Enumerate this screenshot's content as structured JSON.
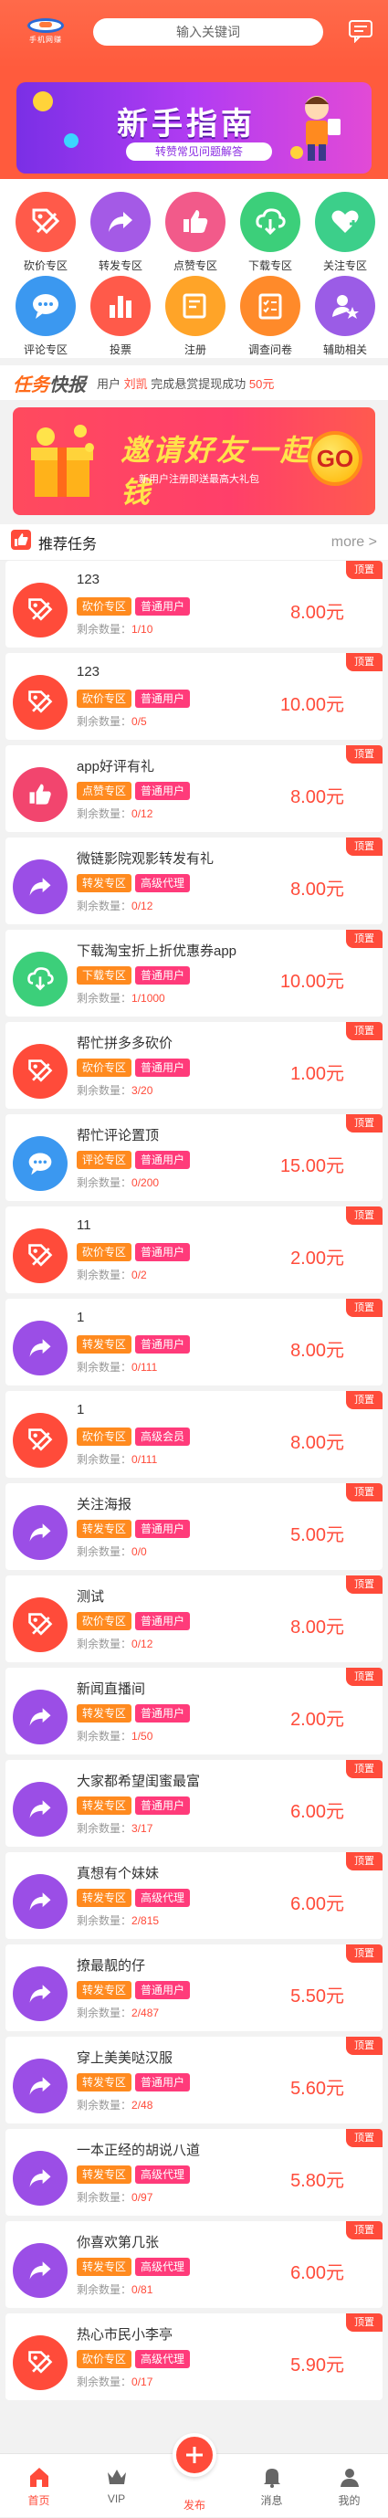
{
  "header": {
    "logo_text": "手机网赚",
    "search_placeholder": "输入关键词"
  },
  "banner": {
    "title": "新手指南",
    "subtitle": "转赞常见问题解答"
  },
  "categories": [
    {
      "label": "砍价专区",
      "icon": "tag-icon",
      "color": "#ff5a4a"
    },
    {
      "label": "转发专区",
      "icon": "share-icon",
      "color": "#a45ae6"
    },
    {
      "label": "点赞专区",
      "icon": "thumbs-up-icon",
      "color": "#f25a8a"
    },
    {
      "label": "下载专区",
      "icon": "download-icon",
      "color": "#3ccf7a"
    },
    {
      "label": "关注专区",
      "icon": "heart-plus-icon",
      "color": "#3ccf8a"
    },
    {
      "label": "评论专区",
      "icon": "comment-icon",
      "color": "#3b98f0"
    },
    {
      "label": "投票",
      "icon": "bar-chart-icon",
      "color": "#ff5a4a"
    },
    {
      "label": "注册",
      "icon": "edit-icon",
      "color": "#ffa428"
    },
    {
      "label": "调查问卷",
      "icon": "survey-icon",
      "color": "#ff8a2a"
    },
    {
      "label": "辅助相关",
      "icon": "user-star-icon",
      "color": "#9b5ce6"
    }
  ],
  "flash": {
    "title_a": "任务",
    "title_b": "快报",
    "prefix": "用户",
    "user": "刘凯",
    "middle": "完成悬赏提现成功",
    "amount": "50元"
  },
  "invite": {
    "title": "邀请好友一起赚钱",
    "subtitle": "新用户注册即送最高大礼包",
    "go": "GO"
  },
  "recommend": {
    "title": "推荐任务",
    "more": "more >"
  },
  "remain_label": "剩余数量：",
  "top_label": "顶置",
  "tag_colors": {
    "砍价专区": "#ff8a1f",
    "转发专区": "#ff8a1f",
    "点赞专区": "#ff8a1f",
    "下载专区": "#ff8a1f",
    "评论专区": "#ff8a1f",
    "普通用户": "#ff3b7a",
    "高级代理": "#ff3b7a",
    "高级会员": "#ff3b7a"
  },
  "tasks": [
    {
      "title": "123",
      "tag1": "砍价专区",
      "tag2": "普通用户",
      "remain": "1/10",
      "price": "8.00元",
      "icon": "tag-icon",
      "color": "#ff4b3a"
    },
    {
      "title": "123",
      "tag1": "砍价专区",
      "tag2": "普通用户",
      "remain": "0/5",
      "price": "10.00元",
      "icon": "tag-icon",
      "color": "#ff4b3a"
    },
    {
      "title": "app好评有礼",
      "tag1": "点赞专区",
      "tag2": "普通用户",
      "remain": "0/12",
      "price": "8.00元",
      "icon": "thumbs-up-icon",
      "color": "#f2456e"
    },
    {
      "title": "微链影院观影转发有礼",
      "tag1": "转发专区",
      "tag2": "高级代理",
      "remain": "0/12",
      "price": "8.00元",
      "icon": "share-icon",
      "color": "#9b4ee6"
    },
    {
      "title": "下载淘宝折上折优惠券app",
      "tag1": "下载专区",
      "tag2": "普通用户",
      "remain": "1/1000",
      "price": "10.00元",
      "icon": "download-icon",
      "color": "#3ccf7a"
    },
    {
      "title": "帮忙拼多多砍价",
      "tag1": "砍价专区",
      "tag2": "普通用户",
      "remain": "3/20",
      "price": "1.00元",
      "icon": "tag-icon",
      "color": "#ff4b3a"
    },
    {
      "title": "帮忙评论置顶",
      "tag1": "评论专区",
      "tag2": "普通用户",
      "remain": "0/200",
      "price": "15.00元",
      "icon": "comment-icon",
      "color": "#3b98f0"
    },
    {
      "title": "11",
      "tag1": "砍价专区",
      "tag2": "普通用户",
      "remain": "0/2",
      "price": "2.00元",
      "icon": "tag-icon",
      "color": "#ff4b3a"
    },
    {
      "title": "1",
      "tag1": "转发专区",
      "tag2": "普通用户",
      "remain": "0/111",
      "price": "8.00元",
      "icon": "share-icon",
      "color": "#9b4ee6"
    },
    {
      "title": "1",
      "tag1": "砍价专区",
      "tag2": "高级会员",
      "remain": "0/111",
      "price": "8.00元",
      "icon": "tag-icon",
      "color": "#ff4b3a"
    },
    {
      "title": "关注海报",
      "tag1": "转发专区",
      "tag2": "普通用户",
      "remain": "0/0",
      "price": "5.00元",
      "icon": "share-icon",
      "color": "#9b4ee6"
    },
    {
      "title": "测试",
      "tag1": "砍价专区",
      "tag2": "普通用户",
      "remain": "0/12",
      "price": "8.00元",
      "icon": "tag-icon",
      "color": "#ff4b3a"
    },
    {
      "title": "新闻直播间",
      "tag1": "转发专区",
      "tag2": "普通用户",
      "remain": "1/50",
      "price": "2.00元",
      "icon": "share-icon",
      "color": "#9b4ee6"
    },
    {
      "title": "大家都希望闺蜜最富",
      "tag1": "转发专区",
      "tag2": "普通用户",
      "remain": "3/17",
      "price": "6.00元",
      "icon": "share-icon",
      "color": "#9b4ee6"
    },
    {
      "title": "真想有个妹妹",
      "tag1": "转发专区",
      "tag2": "高级代理",
      "remain": "2/815",
      "price": "6.00元",
      "icon": "share-icon",
      "color": "#9b4ee6"
    },
    {
      "title": "撩最靓的仔",
      "tag1": "转发专区",
      "tag2": "普通用户",
      "remain": "2/487",
      "price": "5.50元",
      "icon": "share-icon",
      "color": "#9b4ee6"
    },
    {
      "title": "穿上美美哒汉服",
      "tag1": "转发专区",
      "tag2": "普通用户",
      "remain": "2/48",
      "price": "5.60元",
      "icon": "share-icon",
      "color": "#9b4ee6"
    },
    {
      "title": "一本正经的胡说八道",
      "tag1": "转发专区",
      "tag2": "高级代理",
      "remain": "0/97",
      "price": "5.80元",
      "icon": "share-icon",
      "color": "#9b4ee6"
    },
    {
      "title": "你喜欢第几张",
      "tag1": "转发专区",
      "tag2": "高级代理",
      "remain": "0/81",
      "price": "6.00元",
      "icon": "share-icon",
      "color": "#9b4ee6"
    },
    {
      "title": "热心市民小李亭",
      "tag1": "砍价专区",
      "tag2": "高级代理",
      "remain": "0/17",
      "price": "5.90元",
      "icon": "tag-icon",
      "color": "#ff4b3a"
    }
  ],
  "tabbar": {
    "home": "首页",
    "vip": "VIP",
    "publish": "发布",
    "message": "消息",
    "mine": "我的"
  }
}
